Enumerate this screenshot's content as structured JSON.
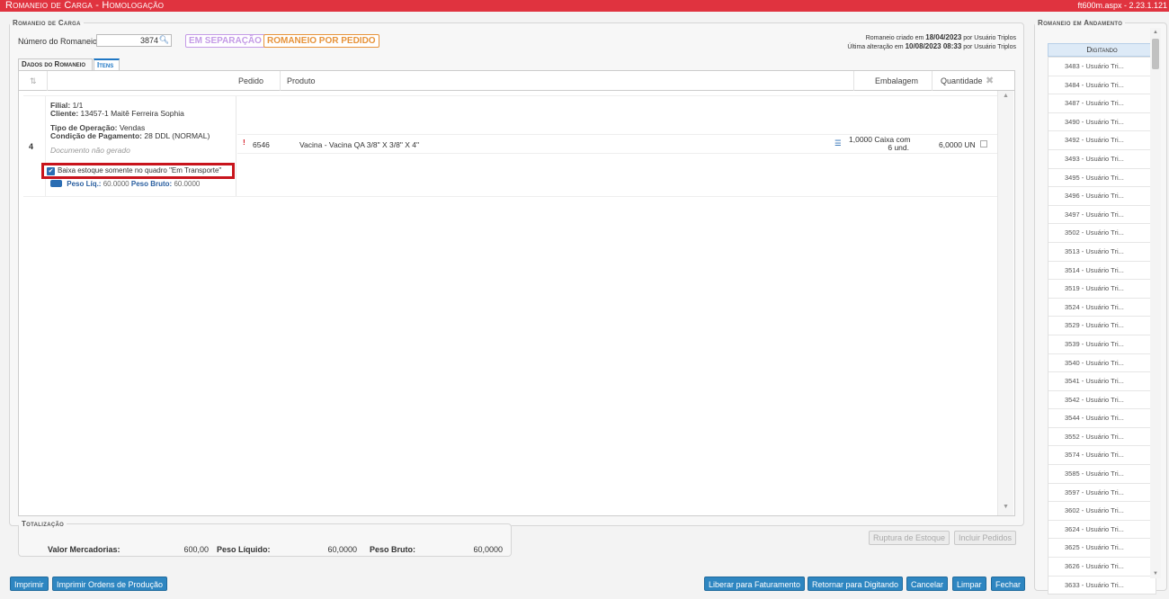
{
  "window": {
    "title": "Romaneio de Carga  - Homologação",
    "version": "ft600m.aspx - 2.23.1.121"
  },
  "form": {
    "legend": "Romaneio de Carga",
    "numero_label": "Número do Romaneio:",
    "numero_value": "3874",
    "badge_separacao": "EM SEPARAÇÃO",
    "badge_pedido": "ROMANEIO POR PEDIDO",
    "criado_prefix": "Romaneio criado em",
    "criado_data": "18/04/2023",
    "criado_por": "por Usuário Triplos",
    "alterado_prefix": "Última alteração em",
    "alterado_data": "10/08/2023 08:33",
    "alterado_por": "por Usuário Triplos"
  },
  "tabs": [
    {
      "label": "Dados do Romaneio"
    },
    {
      "label": "Itens"
    }
  ],
  "grid": {
    "columns": {
      "sort_icon": "sort-icon",
      "pedido": "Pedido",
      "produto": "Produto",
      "embalagem": "Embalagem",
      "quantidade": "Quantidade"
    },
    "row": {
      "number": "4",
      "filial_label": "Filial:",
      "filial_value": "1/1",
      "cliente_label": "Cliente:",
      "cliente_value": "13457-1 Maitê Ferreira Sophia",
      "tipo_label": "Tipo de Operação:",
      "tipo_value": "Vendas",
      "cond_label": "Condição de Pagamento:",
      "cond_value": "28 DDL (NORMAL)",
      "doc_status": "Documento não gerado",
      "checkbox_label": "Baixa estoque somente no quadro \"Em Transporte\"",
      "peso_liq_label": "Peso Líq.:",
      "peso_liq_value": "60.0000",
      "peso_bruto_label": "Peso Bruto:",
      "peso_bruto_value": "60.0000",
      "item": {
        "pedido": "6546",
        "produto": "Vacina - Vacina QA 3/8\" X 3/8\" X 4\"",
        "embalagem_line1": "1,0000 Caixa com",
        "embalagem_line2": "6 und.",
        "quantidade": "6,0000 UN"
      }
    }
  },
  "totalizacao": {
    "legend": "Totalização",
    "valor_label": "Valor Mercadorias:",
    "valor_value": "600,00",
    "peso_liq_label": "Peso Líquido:",
    "peso_liq_value": "60,0000",
    "peso_bruto_label": "Peso Bruto:",
    "peso_bruto_value": "60,0000"
  },
  "buttons": {
    "ruptura": "Ruptura de Estoque",
    "incluir": "Incluir Pedidos",
    "imprimir": "Imprimir",
    "imprimir_ordens": "Imprimir Ordens de Produção",
    "liberar": "Liberar para Faturamento",
    "retornar": "Retornar para Digitando",
    "cancelar": "Cancelar",
    "limpar": "Limpar",
    "fechar": "Fechar"
  },
  "sidebar": {
    "legend": "Romaneio em Andamento",
    "header": "Digitando",
    "items": [
      "3483 - Usuário Tri...",
      "3484 - Usuário Tri...",
      "3487 - Usuário Tri...",
      "3490 - Usuário Tri...",
      "3492 - Usuário Tri...",
      "3493 - Usuário Tri...",
      "3495 - Usuário Tri...",
      "3496 - Usuário Tri...",
      "3497 - Usuário Tri...",
      "3502 - Usuário Tri...",
      "3513 - Usuário Tri...",
      "3514 - Usuário Tri...",
      "3519 - Usuário Tri...",
      "3524 - Usuário Tri...",
      "3529 - Usuário Tri...",
      "3539 - Usuário Tri...",
      "3540 - Usuário Tri...",
      "3541 - Usuário Tri...",
      "3542 - Usuário Tri...",
      "3544 - Usuário Tri...",
      "3552 - Usuário Tri...",
      "3574 - Usuário Tri...",
      "3585 - Usuário Tri...",
      "3597 - Usuário Tri...",
      "3602 - Usuário Tri...",
      "3624 - Usuário Tri...",
      "3625 - Usuário Tri...",
      "3626 - Usuário Tri...",
      "3633 - Usuário Tri..."
    ]
  },
  "colors": {
    "titlebar": "#e0333f",
    "button": "#2e86c1",
    "highlight": "#c8141c",
    "badge_separacao": "#c49be6",
    "badge_pedido": "#e7933a"
  }
}
